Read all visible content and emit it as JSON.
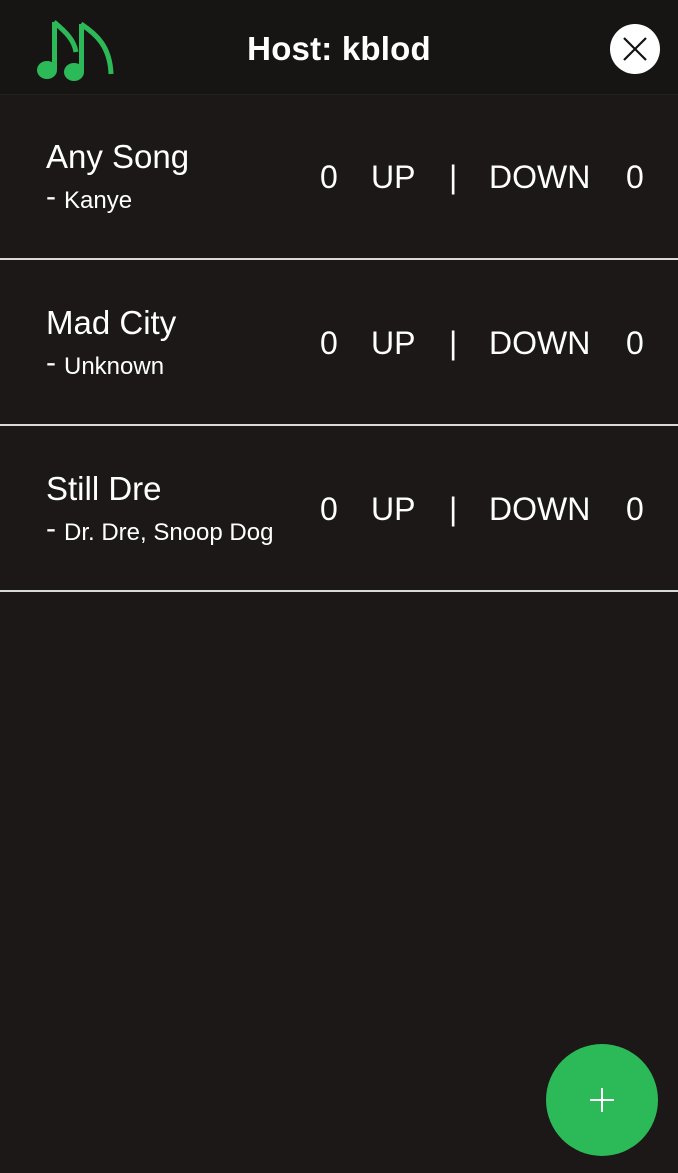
{
  "header": {
    "title": "Host: kblod",
    "logo_icon": "music-notes-icon",
    "close_icon": "close-icon"
  },
  "songs": [
    {
      "title": "Any Song",
      "dash": "-",
      "artist": "Kanye",
      "up_count": "0",
      "up_label": "UP",
      "separator": "|",
      "down_label": "DOWN",
      "down_count": "0"
    },
    {
      "title": "Mad City",
      "dash": "-",
      "artist": "Unknown",
      "up_count": "0",
      "up_label": "UP",
      "separator": "|",
      "down_label": "DOWN",
      "down_count": "0"
    },
    {
      "title": "Still Dre",
      "dash": "-",
      "artist": "Dr. Dre, Snoop Dog",
      "up_count": "0",
      "up_label": "UP",
      "separator": "|",
      "down_label": "DOWN",
      "down_count": "0"
    }
  ],
  "fab": {
    "icon": "plus-icon"
  },
  "colors": {
    "background": "#1b1817",
    "header_background": "#171514",
    "accent_green": "#2cba58",
    "divider": "#d9d9d9",
    "text": "#ffffff"
  }
}
